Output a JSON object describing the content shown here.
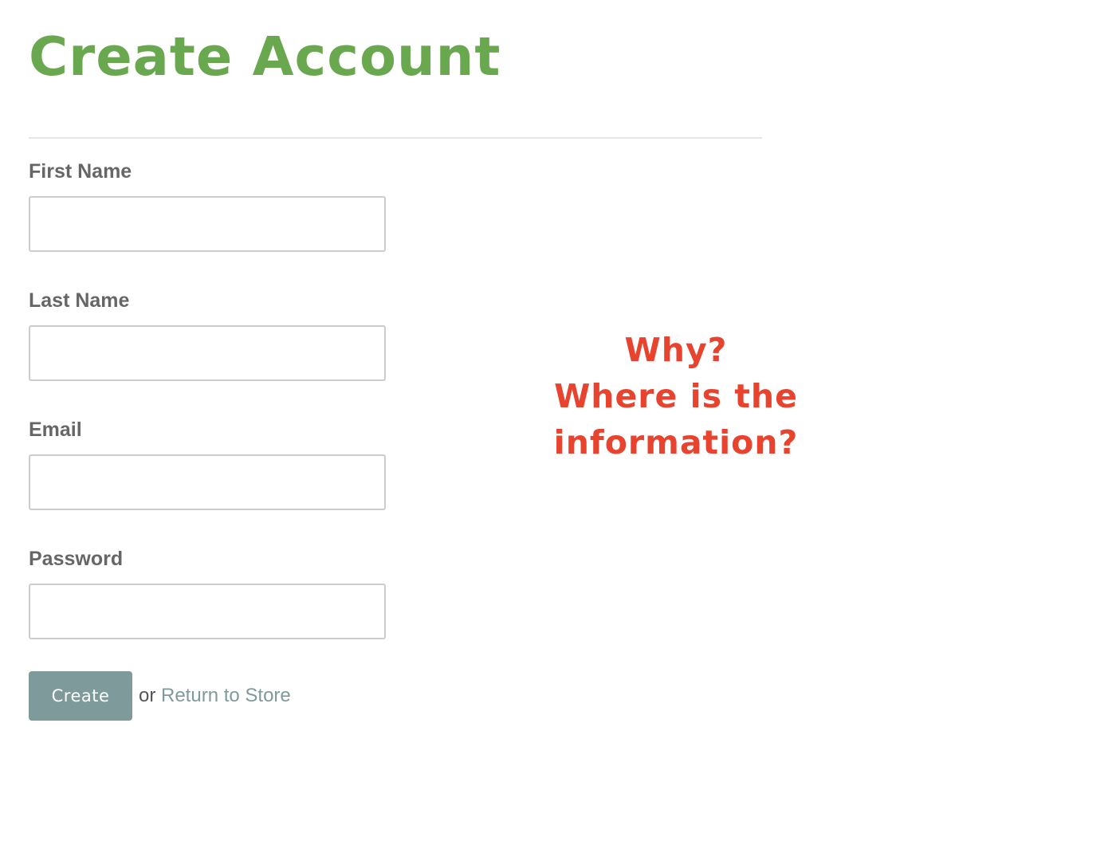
{
  "page": {
    "title": "Create Account"
  },
  "form": {
    "fields": [
      {
        "label": "First Name",
        "value": "",
        "placeholder": ""
      },
      {
        "label": "Last Name",
        "value": "",
        "placeholder": ""
      },
      {
        "label": "Email",
        "value": "",
        "placeholder": ""
      },
      {
        "label": "Password",
        "value": "",
        "placeholder": ""
      }
    ],
    "create_label": "Create",
    "or_text": "or",
    "return_link_label": "Return to Store"
  },
  "annotation": {
    "lines": [
      "Why?",
      "Where is the",
      "information?"
    ]
  },
  "colors": {
    "title": "#6aa84f",
    "label": "#666666",
    "button_bg": "#7f9a9a",
    "link": "#7f9a9a",
    "annotation": "#e8432e",
    "divider": "#e6e6e6",
    "input_border": "#cccccc"
  }
}
